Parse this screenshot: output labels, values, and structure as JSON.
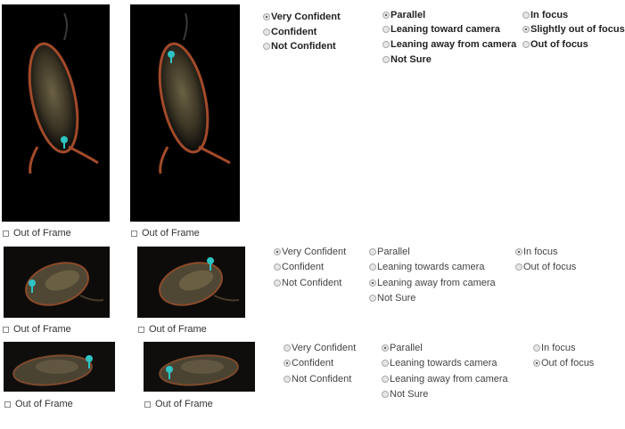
{
  "common": {
    "out_of_frame_label": "Out of Frame"
  },
  "rows": [
    {
      "confidence": [
        {
          "label": "Very Confident",
          "selected": true
        },
        {
          "label": "Confident",
          "selected": false
        },
        {
          "label": "Not Confident",
          "selected": false
        }
      ],
      "orientation": [
        {
          "label": "Parallel",
          "selected": true
        },
        {
          "label": "Leaning toward camera",
          "selected": false
        },
        {
          "label": "Leaning away from camera",
          "selected": false
        },
        {
          "label": "Not Sure",
          "selected": false
        }
      ],
      "focus": [
        {
          "label": "In focus",
          "selected": false
        },
        {
          "label": "Slightly out of focus",
          "selected": true
        },
        {
          "label": "Out of focus",
          "selected": false
        }
      ]
    },
    {
      "confidence": [
        {
          "label": "Very Confident",
          "selected": true
        },
        {
          "label": "Confident",
          "selected": false
        },
        {
          "label": "Not Confident",
          "selected": false
        }
      ],
      "orientation": [
        {
          "label": "Parallel",
          "selected": false
        },
        {
          "label": "Leaning towards camera",
          "selected": false
        },
        {
          "label": "Leaning away from camera",
          "selected": true
        },
        {
          "label": "Not Sure",
          "selected": false
        }
      ],
      "focus": [
        {
          "label": "In focus",
          "selected": true
        },
        {
          "label": "Out of focus",
          "selected": false
        }
      ]
    },
    {
      "confidence": [
        {
          "label": "Very Confident",
          "selected": false
        },
        {
          "label": "Confident",
          "selected": true
        },
        {
          "label": "Not Confident",
          "selected": false
        }
      ],
      "orientation": [
        {
          "label": "Parallel",
          "selected": true
        },
        {
          "label": "Leaning towards camera",
          "selected": false
        },
        {
          "label": "Leaning away from camera",
          "selected": false
        },
        {
          "label": "Not Sure",
          "selected": false
        }
      ],
      "focus": [
        {
          "label": "In focus",
          "selected": false
        },
        {
          "label": "Out of focus",
          "selected": true
        }
      ]
    }
  ],
  "colors": {
    "marker": "#2ec4c4",
    "organism_edge": "#b4472a",
    "organism_fill": "#c9b98a"
  }
}
